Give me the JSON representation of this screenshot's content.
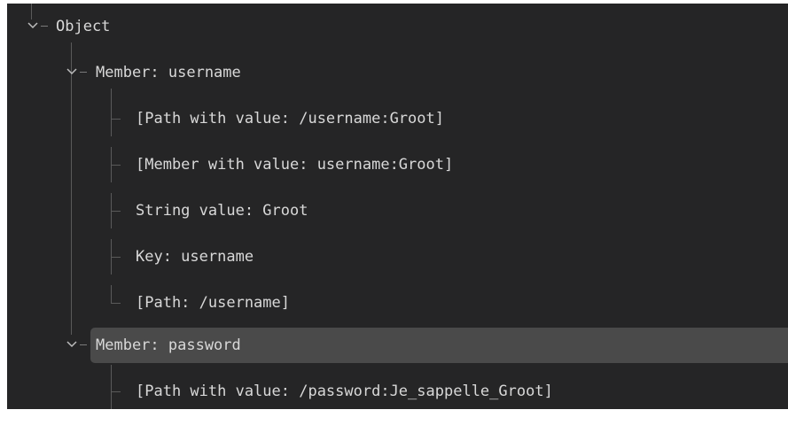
{
  "tree": {
    "root": {
      "label": "Object",
      "expanded": true,
      "icon": "chevron-down-icon"
    },
    "members": [
      {
        "label": "Member: username",
        "expanded": true,
        "selected": false,
        "children": [
          "[Path with value: /username:Groot]",
          "[Member with value: username:Groot]",
          "String value: Groot",
          "Key: username",
          "[Path: /username]"
        ]
      },
      {
        "label": "Member: password",
        "expanded": true,
        "selected": true,
        "children": [
          "[Path with value: /password:Je_sappelle_Groot]"
        ]
      }
    ]
  },
  "colors": {
    "background": "#252526",
    "text": "#d8d8d8",
    "selection": "#4a4a4a",
    "guide_lines": "#5a5a5a"
  }
}
